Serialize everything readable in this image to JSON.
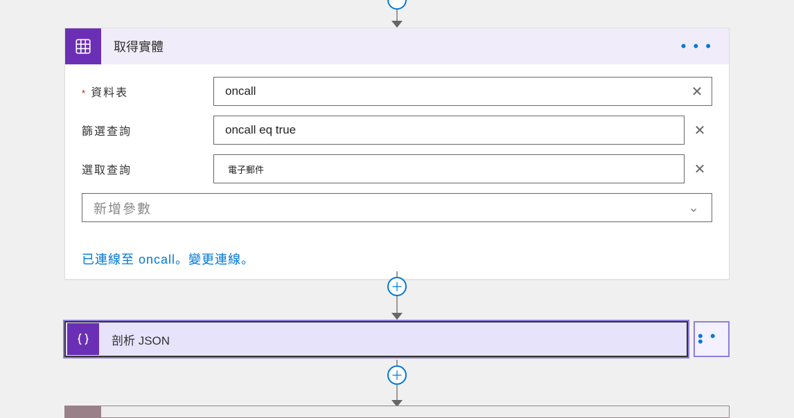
{
  "step1": {
    "title": "取得實體",
    "fields": {
      "table_label": "資料表",
      "table_value": "oncall",
      "filter_label": "篩選查詢",
      "filter_value": "oncall eq true",
      "select_label": "選取查詢",
      "select_value": "電子郵件",
      "add_param_placeholder": "新增參數"
    },
    "connection_prefix": "已連線至 oncall。",
    "connection_link": "變更連線。"
  },
  "step2": {
    "title": "剖析 JSON"
  },
  "icons": {
    "plus": "＋",
    "close": "✕",
    "chevron": "⌄",
    "dots": "• • •"
  }
}
